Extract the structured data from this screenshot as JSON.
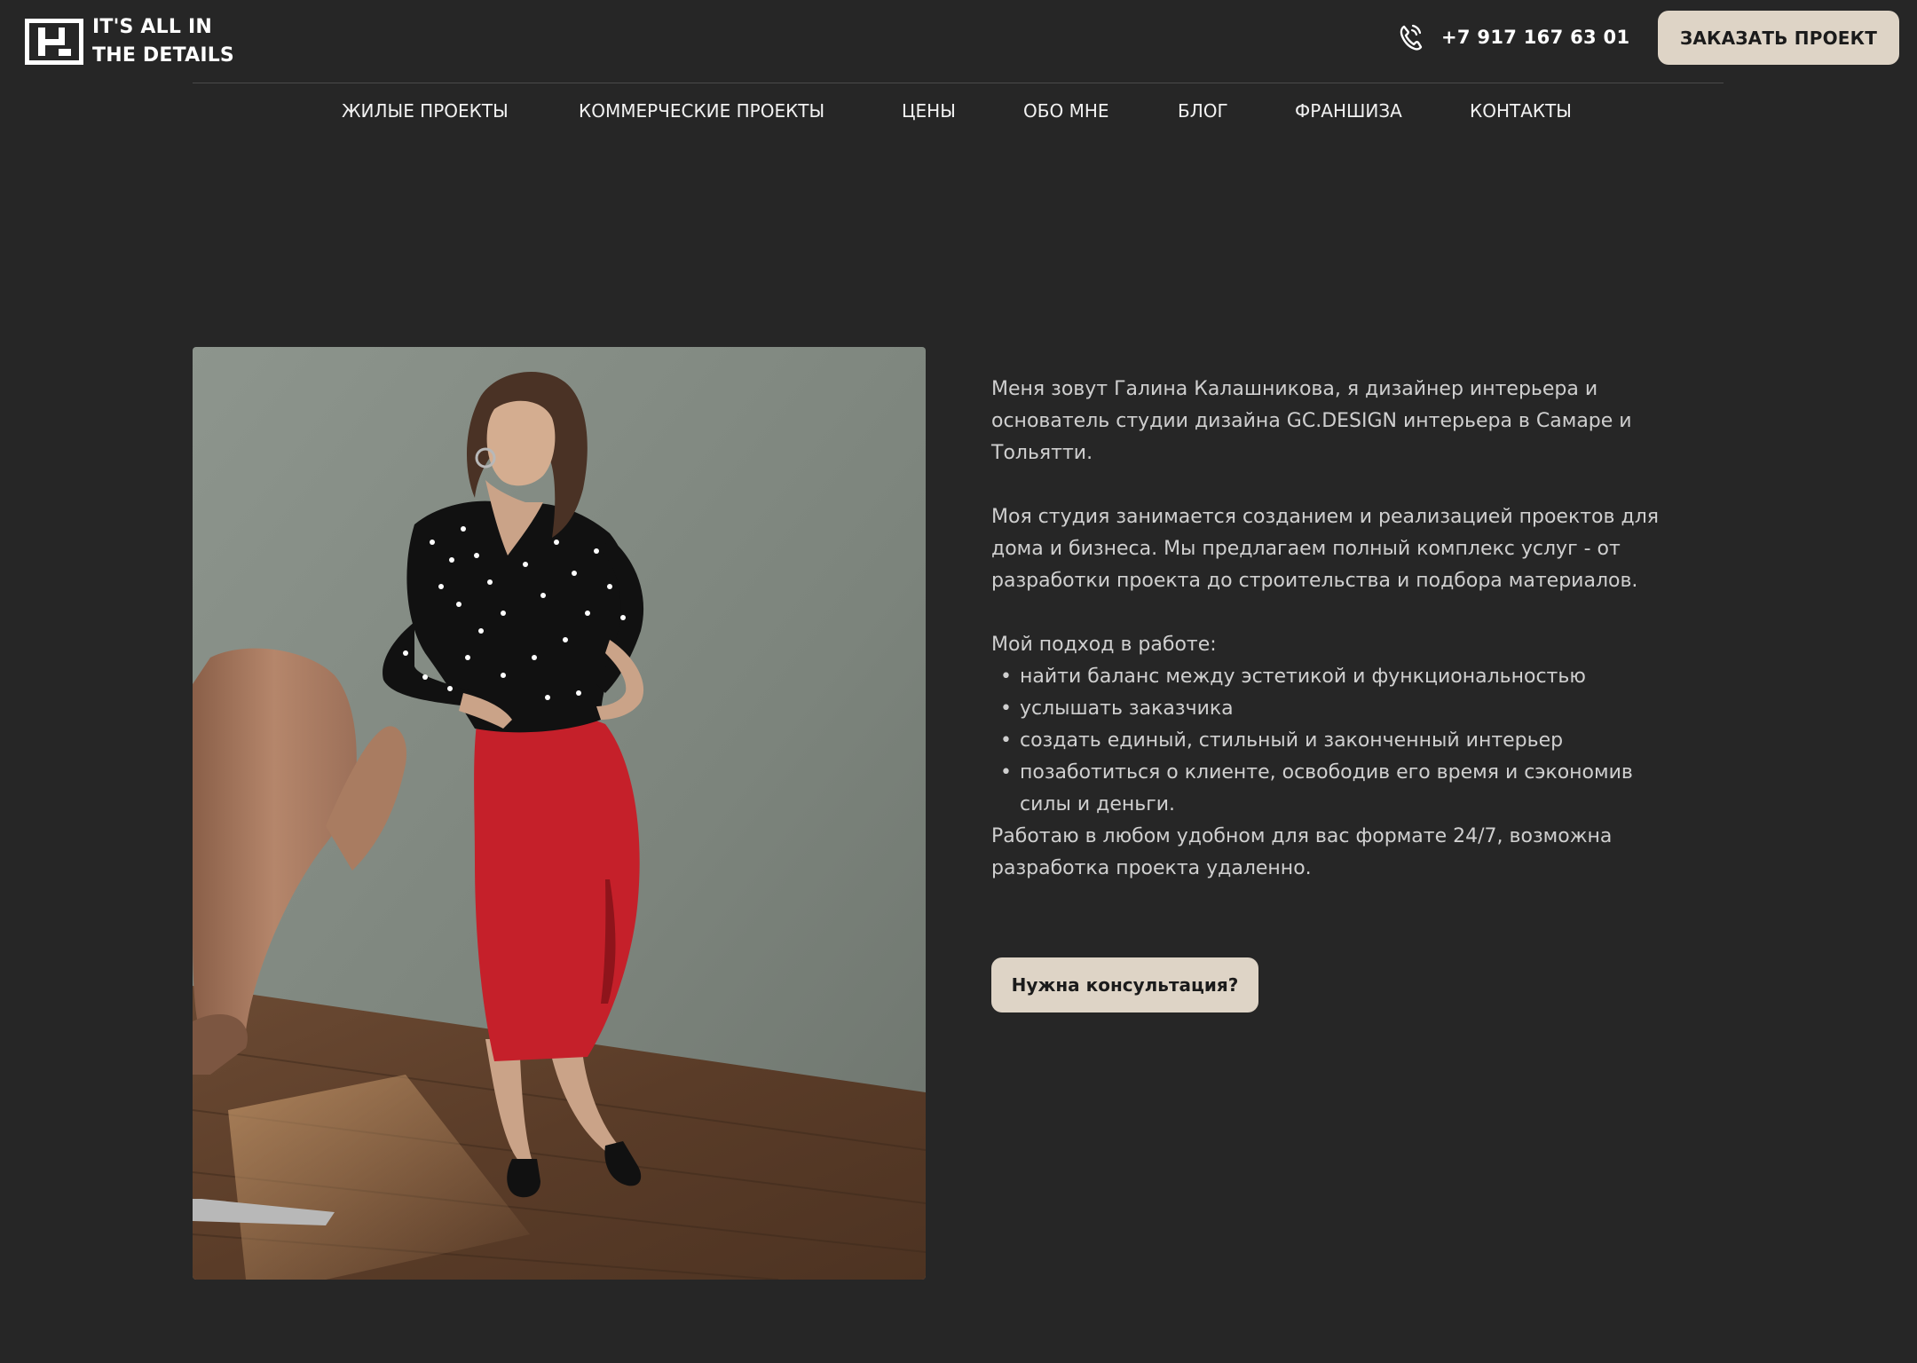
{
  "header": {
    "logo_line1": "IT'S ALL IN",
    "logo_line2": "THE DETAILS",
    "phone": "+7 917 167 63 01",
    "order_button": "ЗАКАЗАТЬ ПРОЕКТ"
  },
  "nav": {
    "items": [
      "ЖИЛЫЕ ПРОЕКТЫ",
      "КОММЕРЧЕСКИЕ ПРОЕКТЫ",
      "ЦЕНЫ",
      "ОБО МНЕ",
      "БЛОГ",
      "ФРАНШИЗА",
      "КОНТАКТЫ"
    ]
  },
  "about": {
    "intro": "Меня зовут Галина Калашникова, я дизайнер интерьера и основатель студии дизайна GC.DESIGN интерьера в Самаре и Тольятти.",
    "studio": "Моя студия занимается созданием и реализацией проектов для дома и бизнеса. Мы предлагаем полный комплекс услуг - от разработки проекта до строительства и подбора материалов.",
    "approach_title": "Мой подход в работе:",
    "approach_items": [
      "найти баланс между эстетикой и функциональностью",
      "услышать заказчика",
      "создать единый, стильный и законченный интерьер",
      "позаботиться о клиенте, освободив его время и сэкономив силы и деньги."
    ],
    "format": "Работаю в любом удобном для вас формате 24/7, возможна разработка проекта удаленно.",
    "consult_button": "Нужна консультация?"
  },
  "colors": {
    "background": "#262626",
    "button_bg": "#ded4c6",
    "button_text": "#1b1b1b",
    "body_text": "#cfcfcf",
    "nav_text": "#f2f2f2"
  },
  "icons": {
    "logo": "logo-mark-icon",
    "phone": "phone-icon"
  }
}
